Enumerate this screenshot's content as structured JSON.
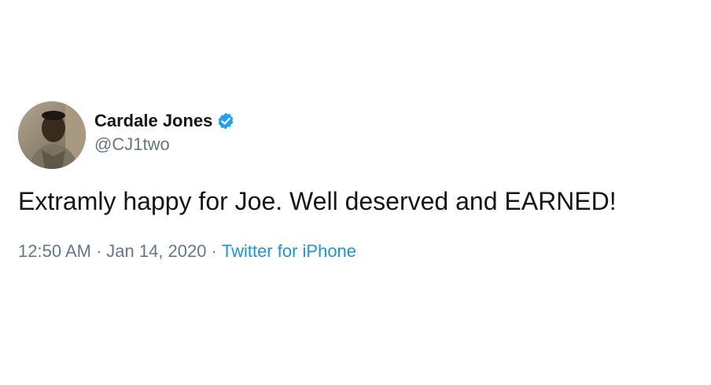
{
  "tweet": {
    "author": {
      "display_name": "Cardale Jones",
      "handle": "@CJ1two",
      "verified": true
    },
    "text": "Extramly happy for Joe. Well deserved and EARNED!",
    "time": "12:50 AM",
    "separator": "·",
    "date": "Jan 14, 2020",
    "source": "Twitter for iPhone"
  },
  "colors": {
    "text_primary": "#14171a",
    "text_secondary": "#657786",
    "link_blue": "#1b95e0",
    "verified_blue": "#1da1f2"
  }
}
